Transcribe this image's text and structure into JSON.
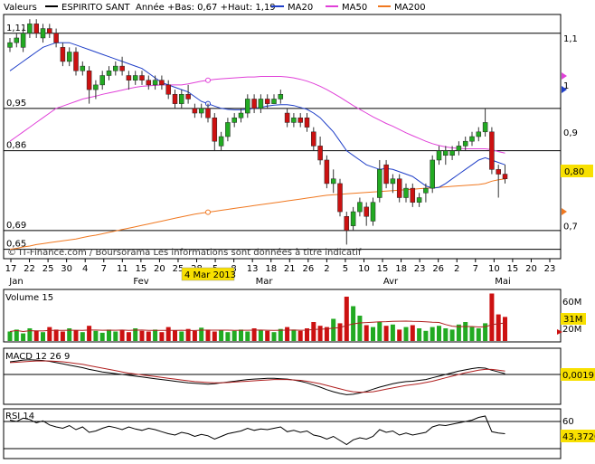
{
  "header": {
    "label": "Valeurs",
    "symbol": "ESPIRITO SANT",
    "range_text": "Année +Bas: 0,67 +Haut: 1,19",
    "legend": [
      {
        "label": "MA20",
        "color": "#1f3fc8"
      },
      {
        "label": "MA50",
        "color": "#e040d8"
      },
      {
        "label": "MA200",
        "color": "#f07820"
      }
    ]
  },
  "watermark": "© IT-Finance.com / Boursorama Les informations sont données à titre indicatif",
  "highlight_date": "4 Mar 2013",
  "x_axis": {
    "day_labels": [
      "17",
      "22",
      "25",
      "30",
      "4",
      "7",
      "11",
      "15",
      "20",
      "25",
      "28",
      "5",
      "8",
      "13",
      "18",
      "21",
      "26",
      "2",
      "5",
      "10",
      "15",
      "18",
      "23",
      "26",
      "2",
      "7",
      "10",
      "15",
      "20",
      "23"
    ],
    "month_labels": [
      "Jan",
      "Fev",
      "Mar",
      "Avr",
      "Mai"
    ]
  },
  "price_axis": {
    "ticks": [
      "1,1",
      "1",
      "0,9",
      "0,8",
      "0,7"
    ],
    "level_labels": [
      "1,11",
      "0,95",
      "0,86",
      "0,69",
      "0,65"
    ],
    "current_value": "0,80"
  },
  "volume_panel": {
    "title": "Volume 15",
    "ticks": [
      "60M",
      "20M"
    ],
    "current_value": "31M"
  },
  "macd_panel": {
    "title": "MACD 12 26 9",
    "current_value": "0,0019"
  },
  "rsi_panel": {
    "title": "RSI 14",
    "ticks": [
      "60"
    ],
    "current_value": "43,3720"
  },
  "colors": {
    "up": "#22aa22",
    "down": "#cc1111",
    "ma20": "#1f3fc8",
    "ma50": "#e040d8",
    "ma200": "#f07820",
    "highlight": "#f8e000",
    "value_tag": "#f8e000",
    "macd_signal": "#b02020"
  },
  "chart_data": {
    "type": "candlestick",
    "title": "ESPIRITO SANT",
    "ylim": [
      0.63,
      1.15
    ],
    "levels": [
      1.11,
      0.95,
      0.86,
      0.69,
      0.65
    ],
    "candles": [
      {
        "o": 1.08,
        "h": 1.1,
        "l": 1.07,
        "c": 1.09
      },
      {
        "o": 1.09,
        "h": 1.11,
        "l": 1.08,
        "c": 1.1
      },
      {
        "o": 1.08,
        "h": 1.12,
        "l": 1.07,
        "c": 1.11
      },
      {
        "o": 1.11,
        "h": 1.14,
        "l": 1.1,
        "c": 1.13
      },
      {
        "o": 1.13,
        "h": 1.14,
        "l": 1.1,
        "c": 1.11
      },
      {
        "o": 1.1,
        "h": 1.13,
        "l": 1.09,
        "c": 1.12
      },
      {
        "o": 1.12,
        "h": 1.13,
        "l": 1.1,
        "c": 1.11
      },
      {
        "o": 1.11,
        "h": 1.12,
        "l": 1.08,
        "c": 1.09
      },
      {
        "o": 1.08,
        "h": 1.09,
        "l": 1.04,
        "c": 1.05
      },
      {
        "o": 1.05,
        "h": 1.08,
        "l": 1.04,
        "c": 1.07
      },
      {
        "o": 1.07,
        "h": 1.08,
        "l": 1.02,
        "c": 1.03
      },
      {
        "o": 1.03,
        "h": 1.05,
        "l": 1.02,
        "c": 1.04
      },
      {
        "o": 1.03,
        "h": 1.04,
        "l": 0.96,
        "c": 0.99
      },
      {
        "o": 0.99,
        "h": 1.01,
        "l": 0.97,
        "c": 1.0
      },
      {
        "o": 1.0,
        "h": 1.03,
        "l": 0.99,
        "c": 1.02
      },
      {
        "o": 1.02,
        "h": 1.04,
        "l": 1.01,
        "c": 1.03
      },
      {
        "o": 1.03,
        "h": 1.05,
        "l": 1.02,
        "c": 1.04
      },
      {
        "o": 1.04,
        "h": 1.06,
        "l": 1.02,
        "c": 1.03
      },
      {
        "o": 1.02,
        "h": 1.03,
        "l": 0.99,
        "c": 1.01
      },
      {
        "o": 1.01,
        "h": 1.03,
        "l": 1.0,
        "c": 1.02
      },
      {
        "o": 1.02,
        "h": 1.03,
        "l": 1.0,
        "c": 1.01
      },
      {
        "o": 1.01,
        "h": 1.02,
        "l": 0.99,
        "c": 1.0
      },
      {
        "o": 1.0,
        "h": 1.02,
        "l": 0.99,
        "c": 1.01
      },
      {
        "o": 1.01,
        "h": 1.02,
        "l": 0.99,
        "c": 1.0
      },
      {
        "o": 1.0,
        "h": 1.01,
        "l": 0.97,
        "c": 0.98
      },
      {
        "o": 0.98,
        "h": 0.99,
        "l": 0.95,
        "c": 0.96
      },
      {
        "o": 0.96,
        "h": 0.99,
        "l": 0.95,
        "c": 0.98
      },
      {
        "o": 0.98,
        "h": 1.0,
        "l": 0.96,
        "c": 0.97
      },
      {
        "o": 0.95,
        "h": 0.96,
        "l": 0.93,
        "c": 0.94
      },
      {
        "o": 0.94,
        "h": 0.96,
        "l": 0.93,
        "c": 0.95
      },
      {
        "o": 0.95,
        "h": 0.96,
        "l": 0.92,
        "c": 0.93
      },
      {
        "o": 0.93,
        "h": 0.94,
        "l": 0.86,
        "c": 0.88
      },
      {
        "o": 0.87,
        "h": 0.9,
        "l": 0.86,
        "c": 0.89
      },
      {
        "o": 0.89,
        "h": 0.93,
        "l": 0.88,
        "c": 0.92
      },
      {
        "o": 0.92,
        "h": 0.94,
        "l": 0.91,
        "c": 0.93
      },
      {
        "o": 0.93,
        "h": 0.95,
        "l": 0.92,
        "c": 0.94
      },
      {
        "o": 0.94,
        "h": 0.98,
        "l": 0.93,
        "c": 0.97
      },
      {
        "o": 0.97,
        "h": 0.98,
        "l": 0.94,
        "c": 0.95
      },
      {
        "o": 0.95,
        "h": 0.98,
        "l": 0.94,
        "c": 0.97
      },
      {
        "o": 0.97,
        "h": 0.98,
        "l": 0.95,
        "c": 0.96
      },
      {
        "o": 0.96,
        "h": 0.98,
        "l": 0.96,
        "c": 0.97
      },
      {
        "o": 0.97,
        "h": 0.99,
        "l": 0.96,
        "c": 0.98
      },
      {
        "o": 0.94,
        "h": 0.95,
        "l": 0.91,
        "c": 0.92
      },
      {
        "o": 0.92,
        "h": 0.94,
        "l": 0.91,
        "c": 0.93
      },
      {
        "o": 0.93,
        "h": 0.94,
        "l": 0.91,
        "c": 0.92
      },
      {
        "o": 0.93,
        "h": 0.94,
        "l": 0.9,
        "c": 0.91
      },
      {
        "o": 0.9,
        "h": 0.91,
        "l": 0.86,
        "c": 0.87
      },
      {
        "o": 0.87,
        "h": 0.89,
        "l": 0.83,
        "c": 0.84
      },
      {
        "o": 0.84,
        "h": 0.85,
        "l": 0.78,
        "c": 0.79
      },
      {
        "o": 0.79,
        "h": 0.82,
        "l": 0.77,
        "c": 0.8
      },
      {
        "o": 0.79,
        "h": 0.8,
        "l": 0.72,
        "c": 0.73
      },
      {
        "o": 0.72,
        "h": 0.73,
        "l": 0.66,
        "c": 0.69
      },
      {
        "o": 0.7,
        "h": 0.74,
        "l": 0.69,
        "c": 0.73
      },
      {
        "o": 0.73,
        "h": 0.76,
        "l": 0.72,
        "c": 0.75
      },
      {
        "o": 0.74,
        "h": 0.75,
        "l": 0.7,
        "c": 0.72
      },
      {
        "o": 0.71,
        "h": 0.76,
        "l": 0.7,
        "c": 0.75
      },
      {
        "o": 0.76,
        "h": 0.84,
        "l": 0.75,
        "c": 0.82
      },
      {
        "o": 0.83,
        "h": 0.84,
        "l": 0.78,
        "c": 0.79
      },
      {
        "o": 0.79,
        "h": 0.81,
        "l": 0.77,
        "c": 0.8
      },
      {
        "o": 0.8,
        "h": 0.81,
        "l": 0.75,
        "c": 0.76
      },
      {
        "o": 0.76,
        "h": 0.79,
        "l": 0.75,
        "c": 0.78
      },
      {
        "o": 0.78,
        "h": 0.79,
        "l": 0.74,
        "c": 0.75
      },
      {
        "o": 0.75,
        "h": 0.77,
        "l": 0.74,
        "c": 0.76
      },
      {
        "o": 0.77,
        "h": 0.79,
        "l": 0.75,
        "c": 0.78
      },
      {
        "o": 0.78,
        "h": 0.85,
        "l": 0.77,
        "c": 0.84
      },
      {
        "o": 0.84,
        "h": 0.87,
        "l": 0.83,
        "c": 0.86
      },
      {
        "o": 0.85,
        "h": 0.87,
        "l": 0.83,
        "c": 0.86
      },
      {
        "o": 0.85,
        "h": 0.87,
        "l": 0.84,
        "c": 0.86
      },
      {
        "o": 0.86,
        "h": 0.88,
        "l": 0.85,
        "c": 0.87
      },
      {
        "o": 0.87,
        "h": 0.89,
        "l": 0.86,
        "c": 0.88
      },
      {
        "o": 0.88,
        "h": 0.9,
        "l": 0.87,
        "c": 0.89
      },
      {
        "o": 0.89,
        "h": 0.91,
        "l": 0.88,
        "c": 0.9
      },
      {
        "o": 0.9,
        "h": 0.95,
        "l": 0.89,
        "c": 0.92
      },
      {
        "o": 0.9,
        "h": 0.91,
        "l": 0.81,
        "c": 0.82
      },
      {
        "o": 0.82,
        "h": 0.83,
        "l": 0.76,
        "c": 0.81
      },
      {
        "o": 0.81,
        "h": 0.83,
        "l": 0.79,
        "c": 0.8
      }
    ],
    "ma20": [
      1.03,
      1.04,
      1.05,
      1.06,
      1.07,
      1.08,
      1.085,
      1.09,
      1.09,
      1.09,
      1.085,
      1.08,
      1.075,
      1.07,
      1.065,
      1.06,
      1.055,
      1.05,
      1.045,
      1.04,
      1.035,
      1.025,
      1.015,
      1.005,
      1.0,
      0.995,
      0.99,
      0.985,
      0.975,
      0.965,
      0.96,
      0.955,
      0.95,
      0.948,
      0.947,
      0.947,
      0.948,
      0.95,
      0.952,
      0.955,
      0.957,
      0.958,
      0.958,
      0.956,
      0.952,
      0.948,
      0.94,
      0.93,
      0.915,
      0.9,
      0.88,
      0.86,
      0.85,
      0.84,
      0.83,
      0.825,
      0.82,
      0.822,
      0.82,
      0.815,
      0.81,
      0.805,
      0.795,
      0.785,
      0.78,
      0.782,
      0.79,
      0.8,
      0.81,
      0.82,
      0.83,
      0.84,
      0.845,
      0.84,
      0.835,
      0.83
    ],
    "ma50": [
      0.88,
      0.89,
      0.9,
      0.91,
      0.92,
      0.93,
      0.94,
      0.95,
      0.955,
      0.96,
      0.965,
      0.97,
      0.973,
      0.976,
      0.98,
      0.983,
      0.986,
      0.989,
      0.992,
      0.995,
      0.997,
      0.998,
      0.999,
      1.0,
      1.0,
      1.0,
      1.0,
      1.002,
      1.005,
      1.008,
      1.01,
      1.012,
      1.013,
      1.014,
      1.015,
      1.016,
      1.017,
      1.017,
      1.018,
      1.018,
      1.018,
      1.018,
      1.017,
      1.015,
      1.012,
      1.008,
      1.003,
      0.997,
      0.99,
      0.982,
      0.974,
      0.965,
      0.956,
      0.948,
      0.94,
      0.932,
      0.925,
      0.918,
      0.912,
      0.905,
      0.898,
      0.892,
      0.886,
      0.88,
      0.875,
      0.871,
      0.868,
      0.866,
      0.865,
      0.864,
      0.864,
      0.864,
      0.864,
      0.862,
      0.858,
      0.855
    ],
    "ma200": [
      0.65,
      0.652,
      0.655,
      0.657,
      0.66,
      0.662,
      0.664,
      0.666,
      0.668,
      0.67,
      0.672,
      0.675,
      0.678,
      0.68,
      0.683,
      0.686,
      0.689,
      0.692,
      0.695,
      0.698,
      0.701,
      0.704,
      0.707,
      0.71,
      0.713,
      0.716,
      0.719,
      0.722,
      0.725,
      0.727,
      0.729,
      0.731,
      0.733,
      0.735,
      0.737,
      0.739,
      0.741,
      0.743,
      0.745,
      0.747,
      0.749,
      0.751,
      0.753,
      0.755,
      0.757,
      0.759,
      0.761,
      0.763,
      0.765,
      0.766,
      0.767,
      0.768,
      0.769,
      0.77,
      0.771,
      0.772,
      0.773,
      0.774,
      0.775,
      0.776,
      0.777,
      0.778,
      0.779,
      0.78,
      0.781,
      0.782,
      0.783,
      0.784,
      0.785,
      0.786,
      0.787,
      0.788,
      0.79,
      0.795,
      0.798,
      0.8
    ],
    "volume": [
      15,
      18,
      12,
      20,
      16,
      14,
      22,
      18,
      15,
      20,
      17,
      14,
      24,
      16,
      13,
      18,
      15,
      17,
      14,
      20,
      16,
      15,
      18,
      14,
      22,
      17,
      15,
      19,
      16,
      21,
      18,
      15,
      17,
      14,
      16,
      18,
      15,
      20,
      17,
      16,
      14,
      19,
      22,
      18,
      16,
      20,
      30,
      24,
      22,
      35,
      28,
      70,
      55,
      40,
      25,
      22,
      30,
      24,
      26,
      18,
      22,
      25,
      20,
      16,
      22,
      24,
      20,
      18,
      26,
      30,
      22,
      20,
      28,
      75,
      42,
      38
    ],
    "macd": [
      0.03,
      0.032,
      0.034,
      0.035,
      0.034,
      0.033,
      0.031,
      0.028,
      0.025,
      0.022,
      0.019,
      0.016,
      0.012,
      0.009,
      0.006,
      0.004,
      0.002,
      0.0,
      -0.002,
      -0.004,
      -0.006,
      -0.008,
      -0.01,
      -0.012,
      -0.014,
      -0.016,
      -0.018,
      -0.02,
      -0.021,
      -0.022,
      -0.023,
      -0.022,
      -0.02,
      -0.018,
      -0.016,
      -0.014,
      -0.012,
      -0.011,
      -0.01,
      -0.009,
      -0.009,
      -0.01,
      -0.011,
      -0.013,
      -0.016,
      -0.02,
      -0.025,
      -0.03,
      -0.036,
      -0.041,
      -0.045,
      -0.048,
      -0.047,
      -0.044,
      -0.04,
      -0.035,
      -0.03,
      -0.026,
      -0.022,
      -0.019,
      -0.017,
      -0.016,
      -0.014,
      -0.012,
      -0.008,
      -0.004,
      0.0,
      0.004,
      0.008,
      0.011,
      0.014,
      0.016,
      0.015,
      0.01,
      0.006,
      0.002
    ],
    "macd_signal": [
      0.028,
      0.029,
      0.03,
      0.031,
      0.032,
      0.032,
      0.032,
      0.031,
      0.03,
      0.028,
      0.026,
      0.024,
      0.021,
      0.018,
      0.015,
      0.012,
      0.009,
      0.006,
      0.003,
      0.001,
      -0.001,
      -0.003,
      -0.005,
      -0.007,
      -0.009,
      -0.011,
      -0.013,
      -0.015,
      -0.017,
      -0.018,
      -0.019,
      -0.02,
      -0.02,
      -0.019,
      -0.018,
      -0.017,
      -0.016,
      -0.015,
      -0.014,
      -0.013,
      -0.012,
      -0.012,
      -0.012,
      -0.013,
      -0.014,
      -0.016,
      -0.019,
      -0.022,
      -0.026,
      -0.03,
      -0.034,
      -0.038,
      -0.041,
      -0.042,
      -0.042,
      -0.041,
      -0.038,
      -0.035,
      -0.032,
      -0.029,
      -0.026,
      -0.024,
      -0.022,
      -0.019,
      -0.016,
      -0.012,
      -0.008,
      -0.004,
      0.0,
      0.004,
      0.007,
      0.01,
      0.012,
      0.012,
      0.01,
      0.008
    ],
    "rsi": [
      62,
      60,
      65,
      63,
      58,
      61,
      55,
      52,
      50,
      54,
      48,
      52,
      44,
      46,
      50,
      53,
      51,
      48,
      52,
      49,
      47,
      50,
      48,
      45,
      42,
      40,
      44,
      42,
      38,
      41,
      39,
      34,
      38,
      42,
      44,
      46,
      50,
      47,
      49,
      48,
      50,
      52,
      45,
      47,
      44,
      46,
      40,
      38,
      34,
      38,
      32,
      26,
      33,
      36,
      34,
      38,
      48,
      44,
      46,
      40,
      43,
      40,
      42,
      44,
      52,
      55,
      54,
      56,
      58,
      60,
      62,
      66,
      68,
      45,
      43,
      42
    ]
  }
}
